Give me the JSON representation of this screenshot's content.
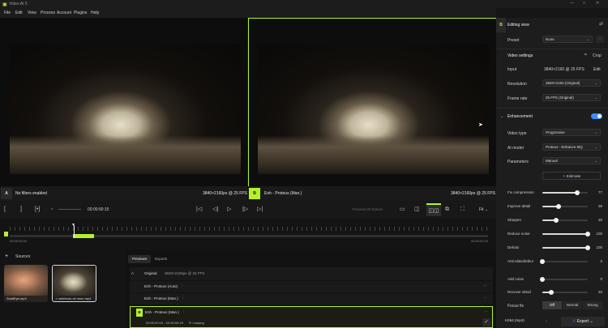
{
  "app": {
    "title": "Video AI 5"
  },
  "menu": [
    "File",
    "Edit",
    "View",
    "Process",
    "Account",
    "Plugins",
    "Help"
  ],
  "viewers": {
    "left": {
      "label": "No filters enabled",
      "resolution": "3840×2160px @ 25 FPS",
      "badge": "A"
    },
    "right": {
      "label": "Enh - Proteus (Man.)",
      "resolution": "3840×2160px @ 25 FPS",
      "badge": "B"
    }
  },
  "transport": {
    "timecode": "00:00:00:15",
    "preview_select": "Preview 30 frames",
    "zoom": "Fit"
  },
  "timeline": {
    "start": "00:00:00:00",
    "end": "00:00:00:19"
  },
  "sources": {
    "title": "Sources",
    "add": "+",
    "items": [
      {
        "name": "SnailEye.mp4"
      },
      {
        "name": "..r notebook-oli mom.mp4"
      }
    ]
  },
  "tabs": [
    "Previews",
    "Exports"
  ],
  "preview_rows": [
    {
      "badge": "A",
      "name": "Original",
      "detail": "3840×2160px @ 25 FPS"
    },
    {
      "name": "Enh - Proteus (Auto)"
    },
    {
      "name": "Enh - Proteus (Man.)"
    },
    {
      "badge": "B",
      "name": "Enh - Proteus (Man.)",
      "sub": "00:00:00:15 - 00:00:00:19",
      "sub2": "Looping"
    }
  ],
  "panel": {
    "badge": "B",
    "title": "Editing view",
    "preset": {
      "label": "Preset",
      "value": "None"
    },
    "video_settings": {
      "title": "Video settings",
      "crop": "Crop"
    },
    "input": {
      "label": "Input",
      "value": "3840×2160 @ 25 FPS",
      "edit": "Edit"
    },
    "resolution": {
      "label": "Resolution",
      "value": "3840×2160 (Original)"
    },
    "frame_rate": {
      "label": "Frame rate",
      "value": "25 FPS (Original)"
    },
    "enhancement": {
      "title": "Enhancement",
      "enabled": true
    },
    "video_type": {
      "label": "Video type",
      "value": "Progressive"
    },
    "ai_model": {
      "label": "AI model",
      "value": "Proteus - Enhance MQ"
    },
    "parameters": {
      "label": "Parameters",
      "value": "Manual"
    },
    "estimate": "Estimate",
    "sliders": [
      {
        "label": "Fix compression",
        "value": 77
      },
      {
        "label": "Improve detail",
        "value": 36
      },
      {
        "label": "Sharpen",
        "value": 30
      },
      {
        "label": "Reduce noise",
        "value": 100
      },
      {
        "label": "Dehalo",
        "value": 100
      },
      {
        "label": "Anti-alias/deblur",
        "value": 0
      },
      {
        "label": "Add noise",
        "value": 0
      },
      {
        "label": "Recover detail",
        "value": 20
      }
    ],
    "focus_fix": {
      "label": "Focus fix",
      "options": [
        "Off",
        "Normal",
        "Strong"
      ],
      "selected": "Off"
    },
    "export_format": "H264 (mp4)",
    "export_button": "Export",
    "accent": "#b5f227",
    "toggle_color": "#3d8bff"
  }
}
